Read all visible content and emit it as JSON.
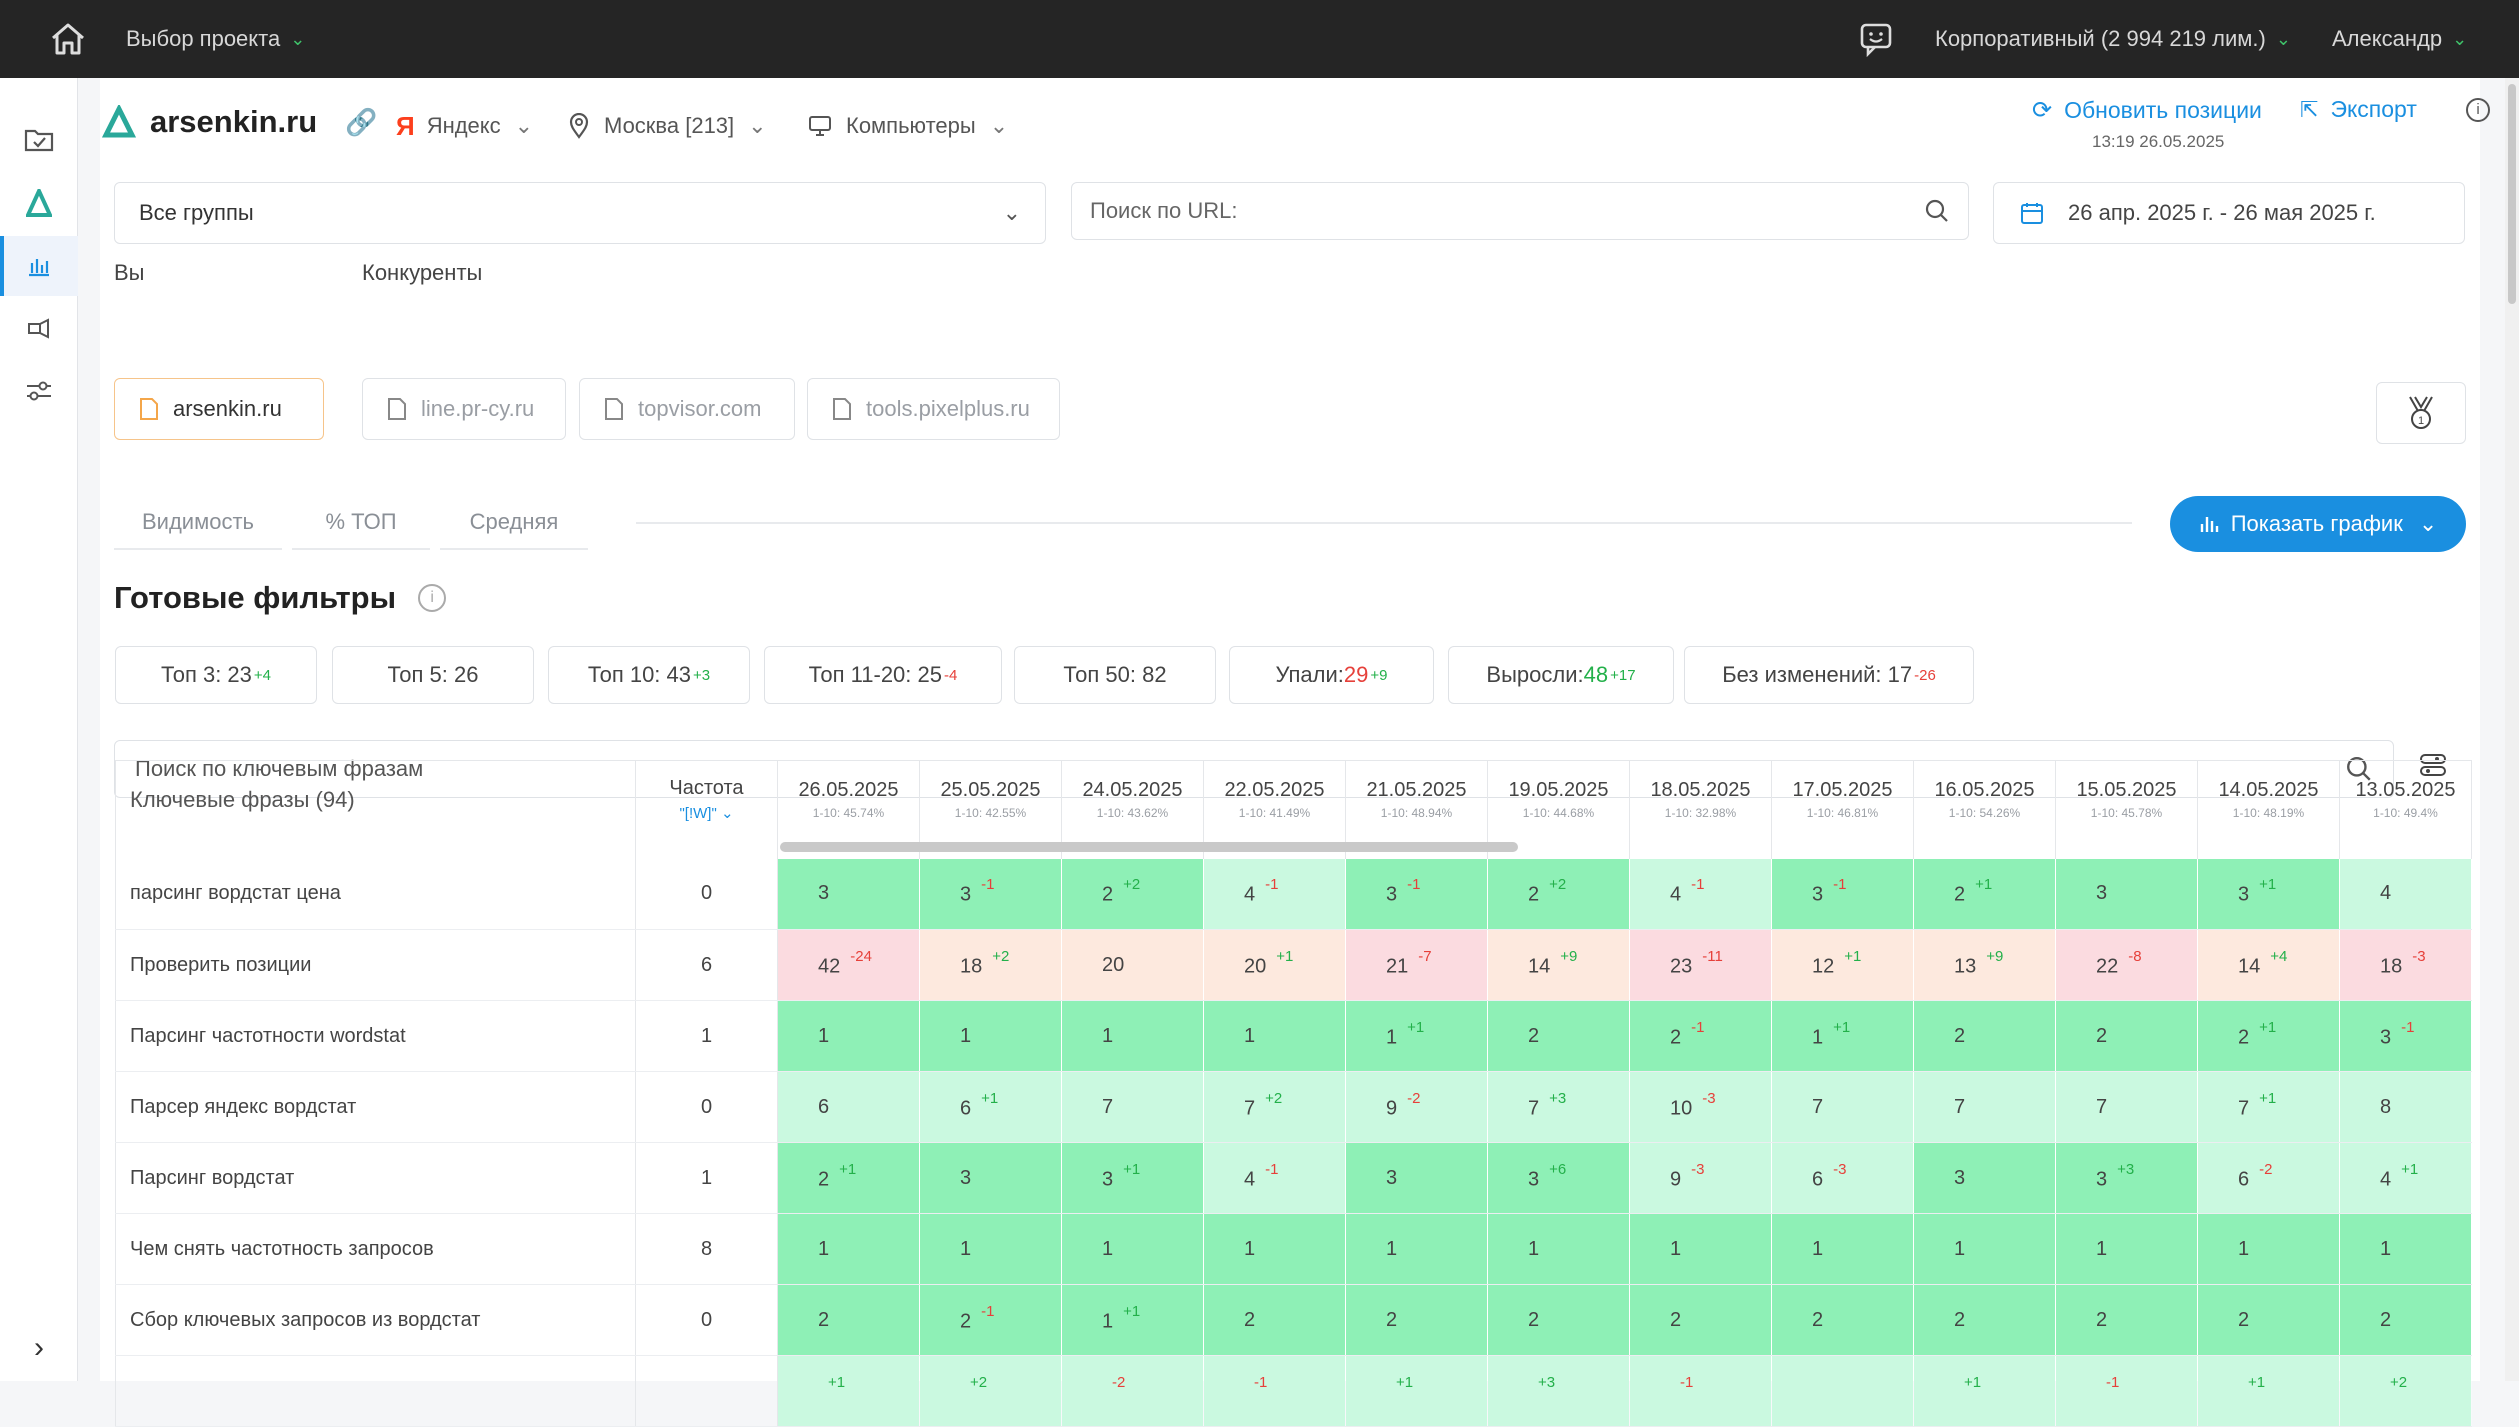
{
  "topbar": {
    "project_select": "Выбор проекта",
    "account": "Корпоративный (2 994 219 лим.)",
    "user": "Александр"
  },
  "project": {
    "domain": "arsenkin.ru",
    "search_engine": "Яндекс",
    "region": "Москва [213]",
    "device": "Компьютеры",
    "update_label": "Обновить позиции",
    "update_time": "13:19 26.05.2025",
    "export_label": "Экспорт"
  },
  "filters": {
    "groups": "Все группы",
    "url_placeholder": "Поиск по URL:",
    "date_range": "26 апр. 2025 г. - 26 мая 2025 г."
  },
  "you": {
    "label": "Вы",
    "site": "arsenkin.ru"
  },
  "competitors": {
    "label": "Конкуренты",
    "sites": [
      "line.pr-cy.ru",
      "topvisor.com",
      "tools.pixelplus.ru"
    ]
  },
  "tabs": [
    "Видимость",
    "% ТОП",
    "Средняя"
  ],
  "show_chart": "Показать график",
  "ready_filters": {
    "title": "Готовые фильтры",
    "chips": [
      {
        "label": "Топ 3: 23",
        "num": "",
        "delta": "+4"
      },
      {
        "label": "Топ 5: 26",
        "num": "",
        "delta": ""
      },
      {
        "label": "Топ 10: 43",
        "num": "",
        "delta": "+3"
      },
      {
        "label": "Топ 11-20: 25",
        "num": "",
        "delta": "-4"
      },
      {
        "label": "Топ 50: 82",
        "num": "",
        "delta": ""
      },
      {
        "label": "Упали: ",
        "num": "29",
        "delta": "+9"
      },
      {
        "label": "Выросли: ",
        "num": "48",
        "delta": "+17"
      },
      {
        "label": "Без изменений: 17",
        "num": "",
        "delta": "-26"
      }
    ]
  },
  "keyword_search_placeholder": "Поиск по ключевым фразам",
  "table": {
    "kw_header": "Ключевые фразы (94)",
    "freq_header": "Частота",
    "freq_sub": "\"[!W]\"",
    "dates": [
      {
        "d": "26.05.2025",
        "s": "1-10: 45.74%"
      },
      {
        "d": "25.05.2025",
        "s": "1-10: 42.55%"
      },
      {
        "d": "24.05.2025",
        "s": "1-10: 43.62%"
      },
      {
        "d": "22.05.2025",
        "s": "1-10: 41.49%"
      },
      {
        "d": "21.05.2025",
        "s": "1-10: 48.94%"
      },
      {
        "d": "19.05.2025",
        "s": "1-10: 44.68%"
      },
      {
        "d": "18.05.2025",
        "s": "1-10: 32.98%"
      },
      {
        "d": "17.05.2025",
        "s": "1-10: 46.81%"
      },
      {
        "d": "16.05.2025",
        "s": "1-10: 54.26%"
      },
      {
        "d": "15.05.2025",
        "s": "1-10: 45.78%"
      },
      {
        "d": "14.05.2025",
        "s": "1-10: 48.19%"
      },
      {
        "d": "13.05.2025",
        "s": "1-10: 49.4%"
      }
    ],
    "rows": [
      {
        "kw": "парсинг вордстат цена",
        "f": "0",
        "cells": [
          [
            "3",
            ""
          ],
          [
            "3",
            "-1"
          ],
          [
            "2",
            "+2"
          ],
          [
            "4",
            "-1"
          ],
          [
            "3",
            "-1"
          ],
          [
            "2",
            "+2"
          ],
          [
            "4",
            "-1"
          ],
          [
            "3",
            "-1"
          ],
          [
            "2",
            "+1"
          ],
          [
            "3",
            ""
          ],
          [
            "3",
            "+1"
          ],
          [
            "4",
            ""
          ]
        ]
      },
      {
        "kw": "Проверить позиции",
        "f": "6",
        "cells": [
          [
            "42",
            "-24"
          ],
          [
            "18",
            "+2"
          ],
          [
            "20",
            ""
          ],
          [
            "20",
            "+1"
          ],
          [
            "21",
            "-7"
          ],
          [
            "14",
            "+9"
          ],
          [
            "23",
            "-11"
          ],
          [
            "12",
            "+1"
          ],
          [
            "13",
            "+9"
          ],
          [
            "22",
            "-8"
          ],
          [
            "14",
            "+4"
          ],
          [
            "18",
            "-3"
          ]
        ]
      },
      {
        "kw": "Парсинг частотности wordstat",
        "f": "1",
        "cells": [
          [
            "1",
            ""
          ],
          [
            "1",
            ""
          ],
          [
            "1",
            ""
          ],
          [
            "1",
            ""
          ],
          [
            "1",
            "+1"
          ],
          [
            "2",
            ""
          ],
          [
            "2",
            "-1"
          ],
          [
            "1",
            "+1"
          ],
          [
            "2",
            ""
          ],
          [
            "2",
            ""
          ],
          [
            "2",
            "+1"
          ],
          [
            "3",
            "-1"
          ]
        ]
      },
      {
        "kw": "Парсер яндекс вордстат",
        "f": "0",
        "cells": [
          [
            "6",
            ""
          ],
          [
            "6",
            "+1"
          ],
          [
            "7",
            ""
          ],
          [
            "7",
            "+2"
          ],
          [
            "9",
            "-2"
          ],
          [
            "7",
            "+3"
          ],
          [
            "10",
            "-3"
          ],
          [
            "7",
            ""
          ],
          [
            "7",
            ""
          ],
          [
            "7",
            ""
          ],
          [
            "7",
            "+1"
          ],
          [
            "8",
            ""
          ]
        ]
      },
      {
        "kw": "Парсинг вордстат",
        "f": "1",
        "cells": [
          [
            "2",
            "+1"
          ],
          [
            "3",
            ""
          ],
          [
            "3",
            "+1"
          ],
          [
            "4",
            "-1"
          ],
          [
            "3",
            ""
          ],
          [
            "3",
            "+6"
          ],
          [
            "9",
            "-3"
          ],
          [
            "6",
            "-3"
          ],
          [
            "3",
            ""
          ],
          [
            "3",
            "+3"
          ],
          [
            "6",
            "-2"
          ],
          [
            "4",
            "+1"
          ]
        ]
      },
      {
        "kw": "Чем снять частотность запросов",
        "f": "8",
        "cells": [
          [
            "1",
            ""
          ],
          [
            "1",
            ""
          ],
          [
            "1",
            ""
          ],
          [
            "1",
            ""
          ],
          [
            "1",
            ""
          ],
          [
            "1",
            ""
          ],
          [
            "1",
            ""
          ],
          [
            "1",
            ""
          ],
          [
            "1",
            ""
          ],
          [
            "1",
            ""
          ],
          [
            "1",
            ""
          ],
          [
            "1",
            ""
          ]
        ]
      },
      {
        "kw": "Сбор ключевых запросов из вордстат",
        "f": "0",
        "cells": [
          [
            "2",
            ""
          ],
          [
            "2",
            "-1"
          ],
          [
            "1",
            "+1"
          ],
          [
            "2",
            ""
          ],
          [
            "2",
            ""
          ],
          [
            "2",
            ""
          ],
          [
            "2",
            ""
          ],
          [
            "2",
            ""
          ],
          [
            "2",
            ""
          ],
          [
            "2",
            ""
          ],
          [
            "2",
            ""
          ],
          [
            "2",
            ""
          ]
        ]
      },
      {
        "kw": "",
        "f": "",
        "cells": [
          [
            "",
            "+1"
          ],
          [
            "",
            "+2"
          ],
          [
            "",
            "-2"
          ],
          [
            "",
            "-1"
          ],
          [
            "",
            "+1"
          ],
          [
            "",
            "+3"
          ],
          [
            "",
            "-1"
          ],
          [
            "",
            ""
          ],
          [
            "",
            "+1"
          ],
          [
            "",
            "-1"
          ],
          [
            "",
            "+1"
          ],
          [
            "",
            "+2"
          ]
        ]
      }
    ]
  },
  "colors": {
    "top3": "#8ef0b6",
    "top10": "#caf9e0",
    "mid": "#fde9de",
    "bad": "#fbdbe0",
    "accent": "#1a8fe0"
  }
}
